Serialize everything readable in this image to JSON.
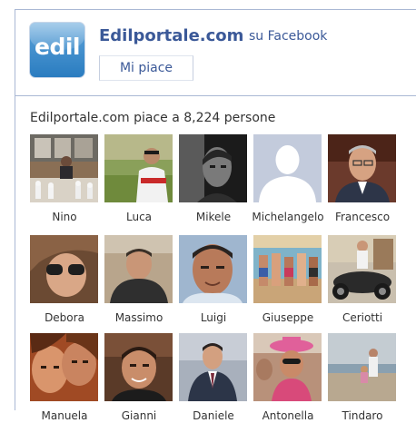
{
  "header": {
    "logo_text": "edil",
    "page_name": "Edilportale.com",
    "platform_text": "su Facebook",
    "like_label": "Mi piace"
  },
  "count_text": "Edilportale.com piace a 8,224 persone",
  "fans": [
    {
      "name": "Nino",
      "photo": "nino-photo"
    },
    {
      "name": "Luca",
      "photo": "luca-photo"
    },
    {
      "name": "Mikele",
      "photo": "mikele-photo"
    },
    {
      "name": "Michelangelo",
      "photo": "default-silhouette"
    },
    {
      "name": "Francesco",
      "photo": "francesco-photo"
    },
    {
      "name": "Debora",
      "photo": "debora-photo"
    },
    {
      "name": "Massimo",
      "photo": "massimo-photo"
    },
    {
      "name": "Luigi",
      "photo": "luigi-photo"
    },
    {
      "name": "Giuseppe",
      "photo": "giuseppe-photo"
    },
    {
      "name": "Ceriotti",
      "photo": "ceriotti-photo"
    },
    {
      "name": "Manuela",
      "photo": "manuela-photo"
    },
    {
      "name": "Gianni",
      "photo": "gianni-photo"
    },
    {
      "name": "Daniele",
      "photo": "daniele-photo"
    },
    {
      "name": "Antonella",
      "photo": "antonella-photo"
    },
    {
      "name": "Tindaro",
      "photo": "tindaro-photo"
    }
  ],
  "colors": {
    "link": "#3b5998",
    "border": "#aab8d4",
    "logo": "#2a7cc0"
  }
}
